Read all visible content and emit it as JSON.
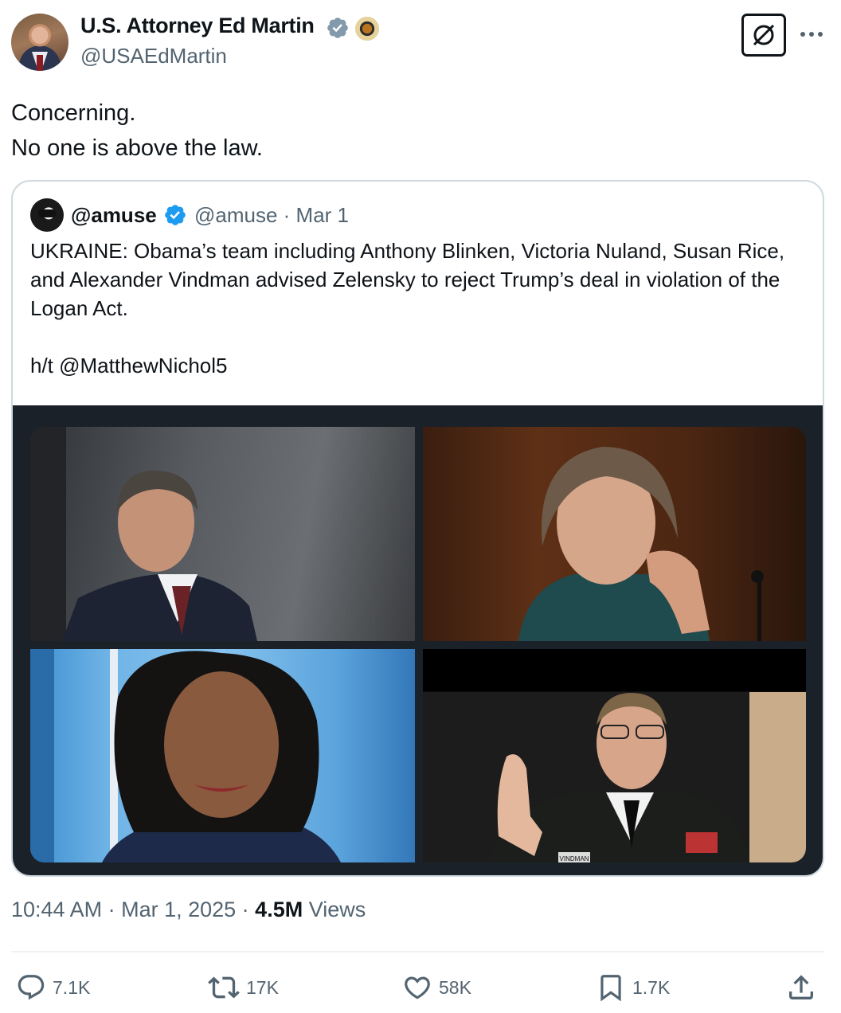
{
  "author": {
    "display_name": "U.S. Attorney Ed Martin",
    "handle": "@USAEdMartin"
  },
  "tweet": {
    "text": "Concerning.\nNo one is above the law."
  },
  "quote": {
    "display_name": "@amuse",
    "handle": "@amuse",
    "date": "Mar 1",
    "text": "UKRAINE: Obama’s team including Anthony Blinken, Victoria Nuland, Susan Rice, and Alexander Vindman advised Zelensky to reject Trump’s deal in violation of the Logan Act.\n\nh/t @MatthewNichol5",
    "media_caption": "VINDMAN"
  },
  "meta": {
    "time": "10:44 AM",
    "date": "Mar 1, 2025",
    "views_count": "4.5M",
    "views_label": "Views"
  },
  "actions": {
    "replies": "7.1K",
    "reposts": "17K",
    "likes": "58K",
    "bookmarks": "1.7K"
  },
  "icons": [
    "verified-grey-badge-icon",
    "doj-seal-icon",
    "grok-icon",
    "more-icon",
    "verified-blue-badge-icon",
    "reply-icon",
    "repost-icon",
    "like-icon",
    "bookmark-icon",
    "share-icon"
  ],
  "colors": {
    "text": "#0f1419",
    "secondary": "#536471",
    "verified_blue": "#1d9bf0",
    "verified_grey": "#829aab",
    "border": "#cfd9de"
  }
}
